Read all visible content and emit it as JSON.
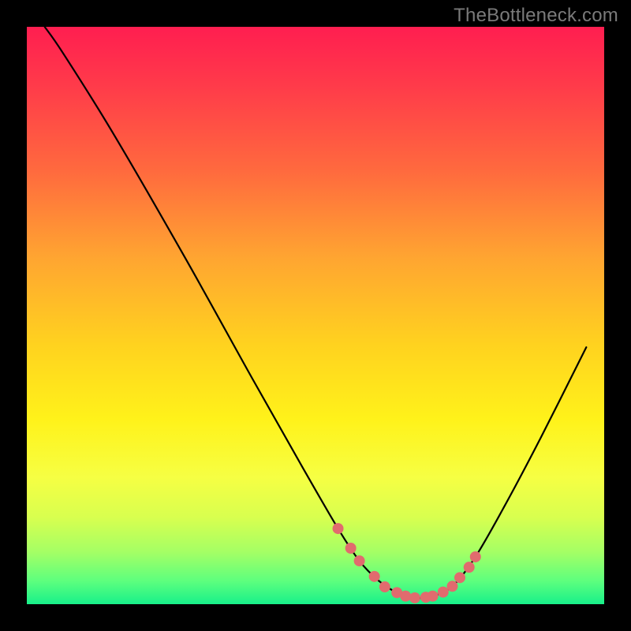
{
  "watermark": "TheBottleneck.com",
  "chart_data": {
    "type": "line",
    "title": "",
    "xlabel": "",
    "ylabel": "",
    "xlim": [
      0,
      100
    ],
    "ylim": [
      0,
      100
    ],
    "grid": false,
    "legend": false,
    "series": [
      {
        "name": "bottleneck-curve",
        "x": [
          3.1,
          6.3,
          14.8,
          27.3,
          39.1,
          47.7,
          53.9,
          57.6,
          60.9,
          64.1,
          67.2,
          70.3,
          73.7,
          77.7,
          82.8,
          89.1,
          96.9
        ],
        "y": [
          100.0,
          95.4,
          81.8,
          60.2,
          39.0,
          23.8,
          13.1,
          7.5,
          4.1,
          2.0,
          1.1,
          1.4,
          3.1,
          8.2,
          17.1,
          29.0,
          44.5
        ]
      }
    ],
    "markers": {
      "name": "highlight-region",
      "color": "#e16b6e",
      "x": [
        53.9,
        56.1,
        57.6,
        60.2,
        62.0,
        64.1,
        65.6,
        67.2,
        69.1,
        70.3,
        72.1,
        73.7,
        75.0,
        76.6,
        77.7
      ],
      "y": [
        13.1,
        9.7,
        7.5,
        4.8,
        3.0,
        2.0,
        1.4,
        1.1,
        1.2,
        1.4,
        2.1,
        3.1,
        4.6,
        6.4,
        8.2
      ]
    },
    "gradient_stops": [
      {
        "pos": 0,
        "color": "#ff1e50"
      },
      {
        "pos": 25,
        "color": "#ff6a3e"
      },
      {
        "pos": 55,
        "color": "#ffd21f"
      },
      {
        "pos": 78,
        "color": "#f6ff43"
      },
      {
        "pos": 96,
        "color": "#5dff7e"
      },
      {
        "pos": 100,
        "color": "#18f08a"
      }
    ]
  }
}
